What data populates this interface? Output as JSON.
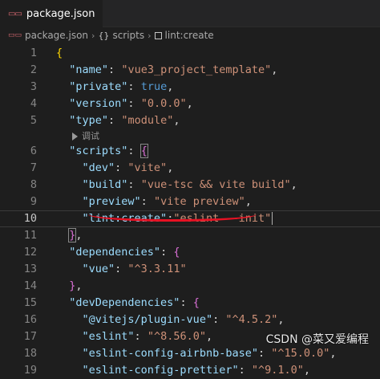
{
  "tab": {
    "icon": "json-file-icon",
    "label": "package.json"
  },
  "breadcrumb": {
    "file": "package.json",
    "sep1": "›",
    "node1": "scripts",
    "sep2": "›",
    "node2": "lint:create"
  },
  "codelens": {
    "label": "调试"
  },
  "lines": [
    {
      "n": "1",
      "text": "{"
    },
    {
      "n": "2",
      "text": "\"name\": \"vue3_project_template\","
    },
    {
      "n": "3",
      "text": "\"private\": true,"
    },
    {
      "n": "4",
      "text": "\"version\": \"0.0.0\","
    },
    {
      "n": "5",
      "text": "\"type\": \"module\","
    },
    {
      "n": "6",
      "text": "\"scripts\": {"
    },
    {
      "n": "7",
      "text": "\"dev\": \"vite\","
    },
    {
      "n": "8",
      "text": "\"build\": \"vue-tsc && vite build\","
    },
    {
      "n": "9",
      "text": "\"preview\": \"vite preview\","
    },
    {
      "n": "10",
      "text": "\"lint:create\":\"eslint --init\""
    },
    {
      "n": "11",
      "text": "},"
    },
    {
      "n": "12",
      "text": "\"dependencies\": {"
    },
    {
      "n": "13",
      "text": "\"vue\": \"^3.3.11\""
    },
    {
      "n": "14",
      "text": "},"
    },
    {
      "n": "15",
      "text": "\"devDependencies\": {"
    },
    {
      "n": "16",
      "text": "\"@vitejs/plugin-vue\": \"^4.5.2\","
    },
    {
      "n": "17",
      "text": "\"eslint\": \"^8.56.0\","
    },
    {
      "n": "18",
      "text": "\"eslint-config-airbnb-base\": \"^15.0.0\","
    },
    {
      "n": "19",
      "text": "\"eslint-config-prettier\": \"^9.1.0\","
    }
  ],
  "watermark": "CSDN @菜又爱编程",
  "colors": {
    "key": "#9cdcfe",
    "string": "#ce9178",
    "boolean": "#569cd6",
    "underline": "#e81123"
  }
}
